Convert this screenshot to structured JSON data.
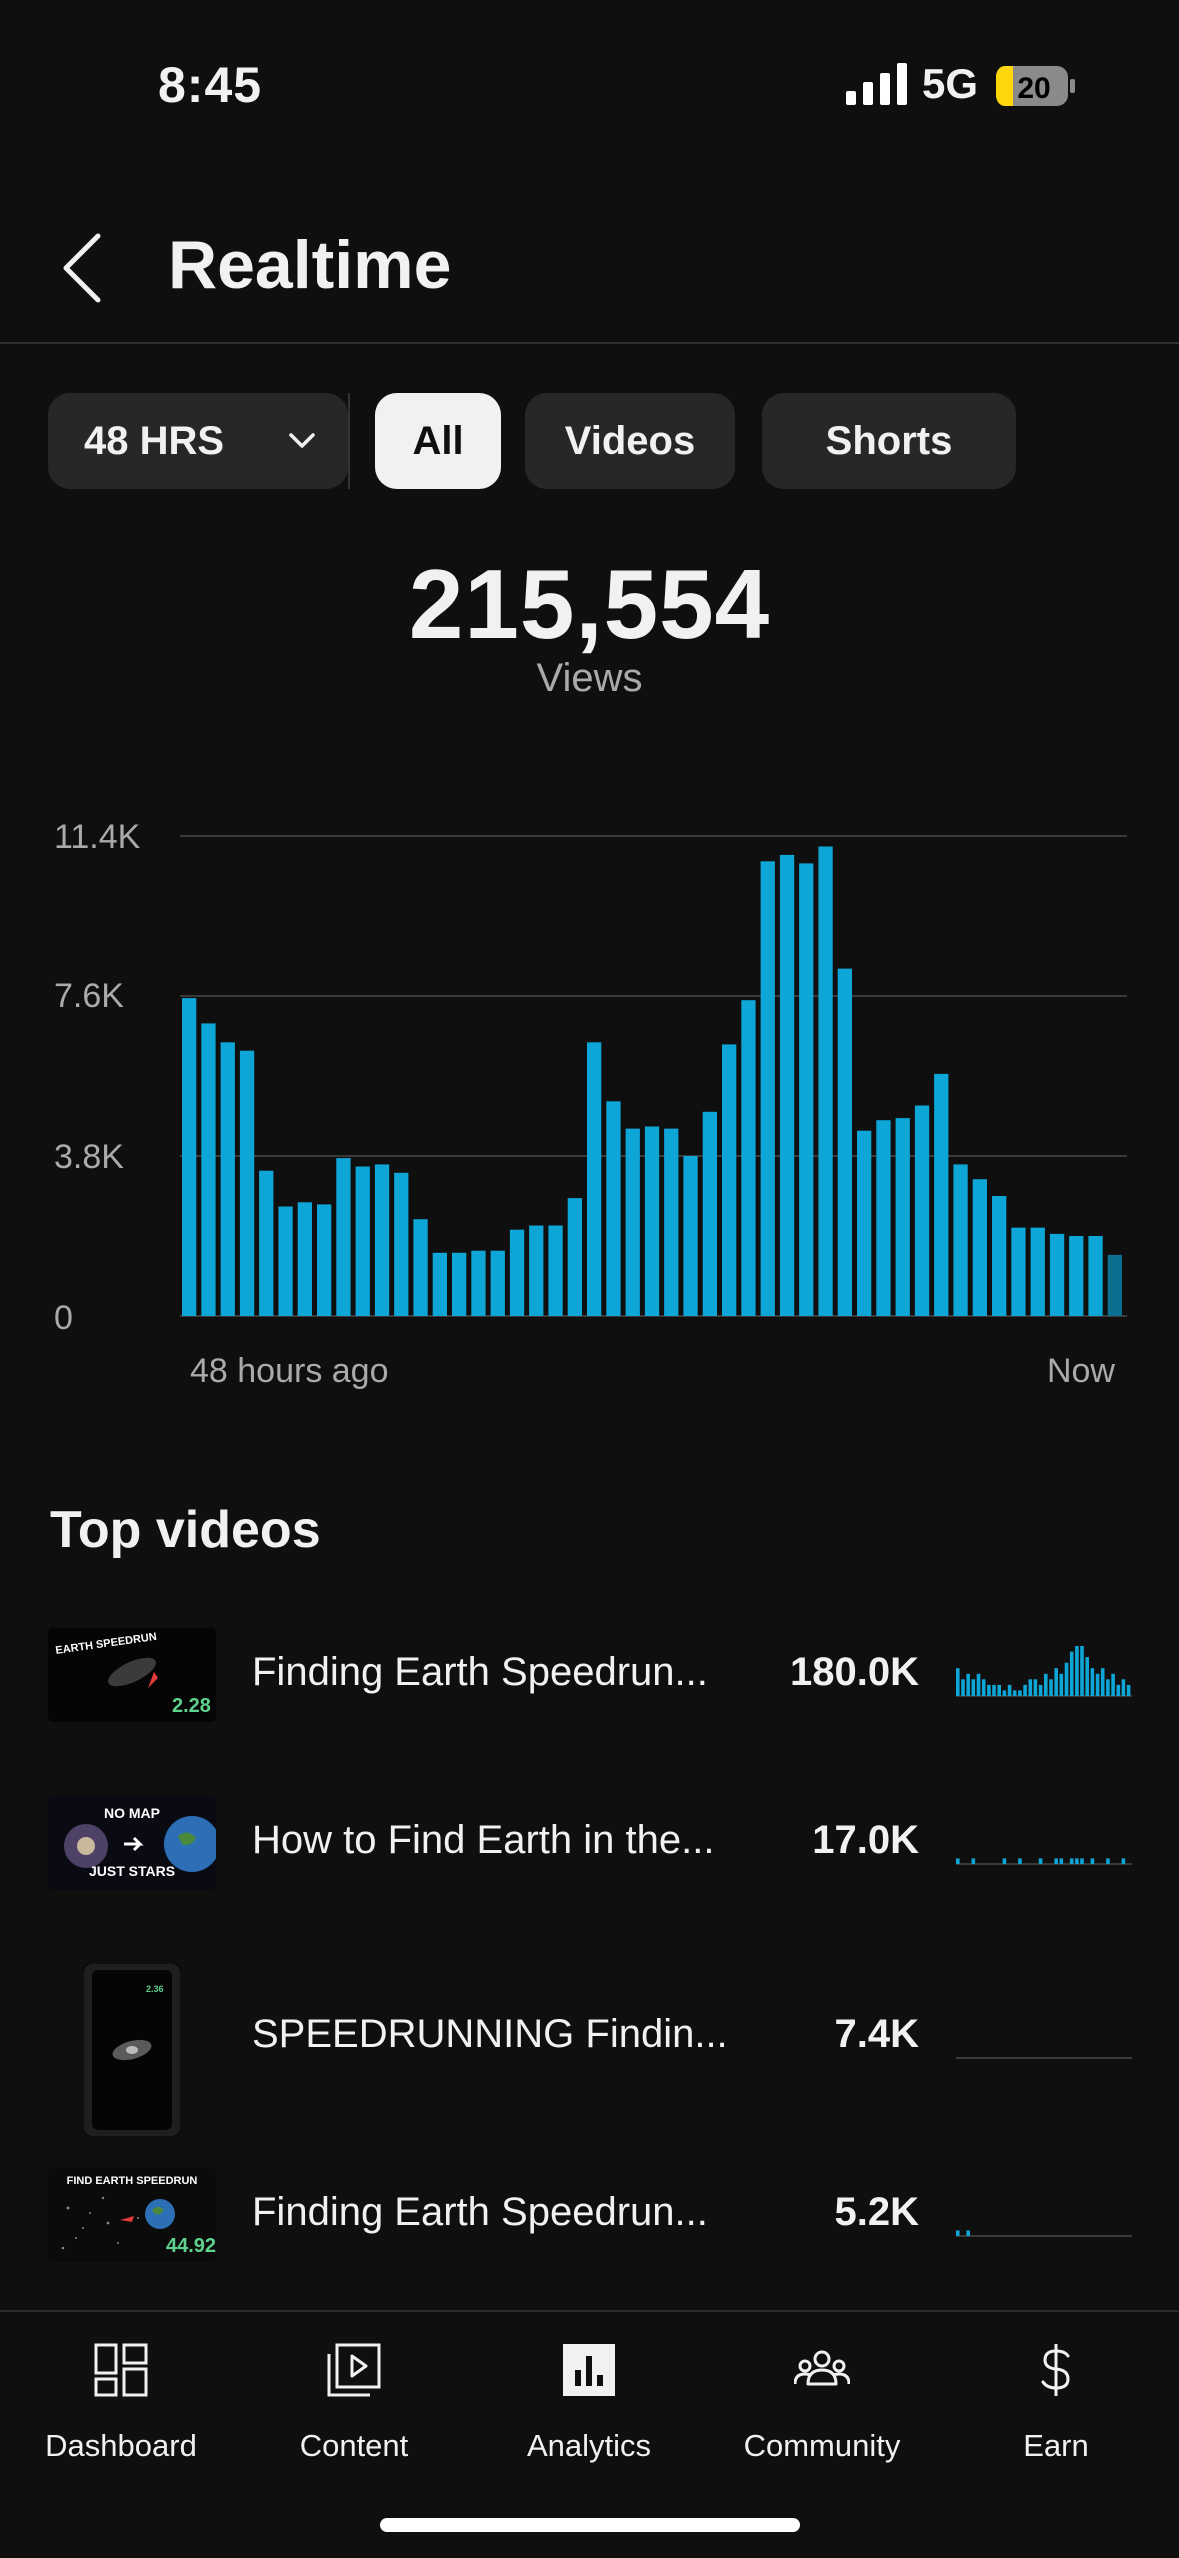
{
  "status_bar": {
    "time": "8:45",
    "network": "5G",
    "battery": "20"
  },
  "header": {
    "title": "Realtime"
  },
  "filters": {
    "range_label": "48 HRS",
    "chips": [
      "All",
      "Videos",
      "Shorts"
    ],
    "active": "All"
  },
  "summary": {
    "total": "215,554",
    "label": "Views"
  },
  "chart_data": {
    "type": "bar",
    "title": "",
    "xlabel": "",
    "ylabel": "",
    "x_start_label": "48 hours ago",
    "x_end_label": "Now",
    "y_ticks": [
      "11.4K",
      "7.6K",
      "3.8K",
      "0"
    ],
    "ylim": [
      0,
      11400
    ],
    "grid": true,
    "bar_color": "#0ea5d7",
    "values": [
      7550,
      6950,
      6500,
      6300,
      3450,
      2600,
      2700,
      2650,
      3750,
      3550,
      3600,
      3400,
      2300,
      1500,
      1500,
      1550,
      1550,
      2050,
      2150,
      2150,
      2800,
      6500,
      5100,
      4450,
      4500,
      4450,
      3800,
      4850,
      6450,
      7500,
      10800,
      10950,
      10750,
      11150,
      8250,
      4400,
      4650,
      4700,
      5000,
      5750,
      3600,
      3250,
      2850,
      2100,
      2100,
      1950,
      1900,
      1900,
      1450
    ]
  },
  "top_videos": {
    "title": "Top videos",
    "items": [
      {
        "title": "Finding Earth Speedrun...",
        "views": "180.0K",
        "thumb_text": "EARTH SPEEDRUN",
        "thumb_num": "2.28",
        "spark": [
          5,
          3,
          4,
          3,
          4,
          3,
          2,
          2,
          2,
          1,
          2,
          1,
          1,
          2,
          3,
          3,
          2,
          4,
          3,
          5,
          4,
          6,
          8,
          9,
          9,
          7,
          5,
          4,
          5,
          3,
          4,
          2,
          3,
          2
        ]
      },
      {
        "title": "How to Find Earth in the...",
        "views": "17.0K",
        "thumb_top": "NO MAP",
        "thumb_bottom": "JUST STARS",
        "spark": [
          1,
          0,
          0,
          1,
          0,
          0,
          0,
          0,
          0,
          1,
          0,
          0,
          1,
          0,
          0,
          0,
          1,
          0,
          0,
          1,
          1,
          0,
          1,
          1,
          1,
          0,
          1,
          0,
          0,
          1,
          0,
          0,
          1,
          0
        ]
      },
      {
        "title": "SPEEDRUNNING Findin...",
        "views": "7.4K",
        "thumb_num": "2.36",
        "spark": []
      },
      {
        "title": "Finding Earth Speedrun...",
        "views": "5.2K",
        "thumb_text": "FIND EARTH SPEEDRUN",
        "thumb_num": "44.92",
        "spark": [
          1,
          0,
          1,
          0,
          0,
          0,
          0,
          0,
          0,
          0,
          0,
          0,
          0,
          0,
          0,
          0,
          0,
          0,
          0,
          0,
          0,
          0,
          0,
          0,
          0,
          0,
          0,
          0,
          0,
          0,
          0,
          0,
          0,
          0
        ]
      }
    ]
  },
  "bottom_nav": {
    "items": [
      {
        "label": "Dashboard",
        "icon": "dashboard-icon"
      },
      {
        "label": "Content",
        "icon": "content-icon"
      },
      {
        "label": "Analytics",
        "icon": "analytics-icon"
      },
      {
        "label": "Community",
        "icon": "community-icon"
      },
      {
        "label": "Earn",
        "icon": "earn-icon"
      }
    ],
    "active": "Analytics"
  }
}
